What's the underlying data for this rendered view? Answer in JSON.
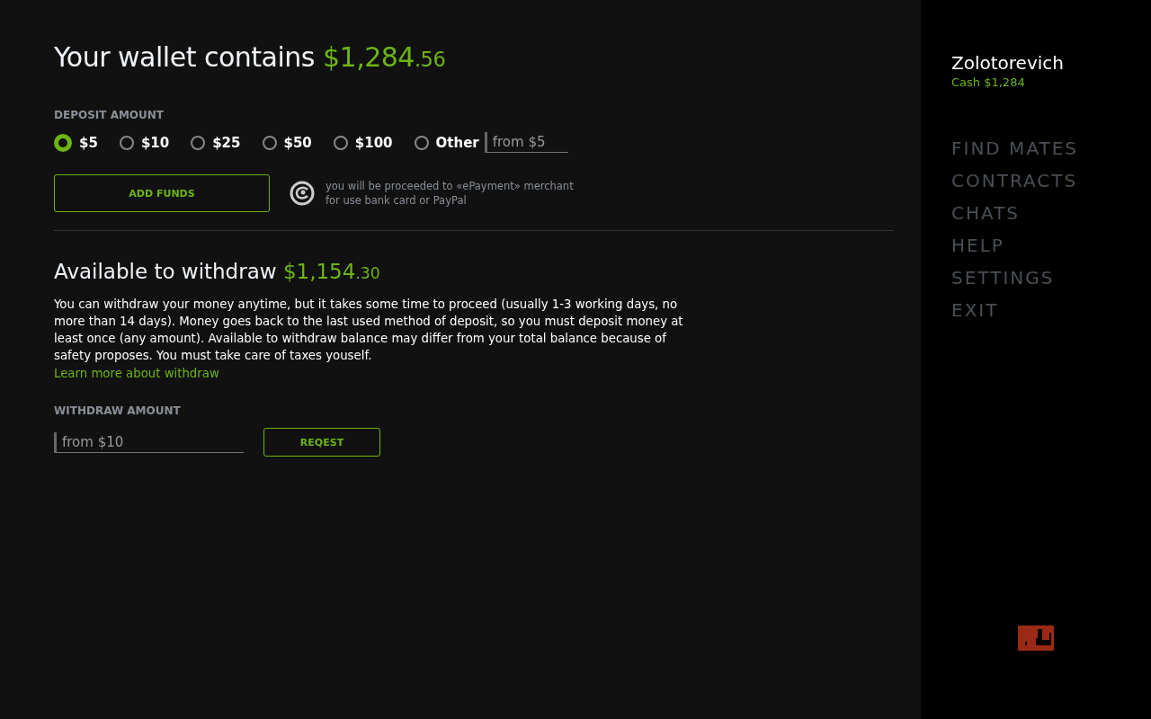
{
  "wallet": {
    "title": "Your wallet contains",
    "amount": "$1,284",
    "cents": ".56"
  },
  "deposit": {
    "label": "DEPOSIT AMOUNT",
    "options": [
      {
        "label": "$5",
        "selected": true
      },
      {
        "label": "$10",
        "selected": false
      },
      {
        "label": "$25",
        "selected": false
      },
      {
        "label": "$50",
        "selected": false
      },
      {
        "label": "$100",
        "selected": false
      },
      {
        "label": "Other",
        "selected": false
      }
    ],
    "other_placeholder": "from $5",
    "button": "ADD FUNDS",
    "note": [
      "you will be proceeded to «ePayment» merchant",
      "for use bank card or PayPal"
    ]
  },
  "withdraw": {
    "title": "Available to withdraw",
    "amount": "$1,154",
    "cents": ".30",
    "description": "You can withdraw your money anytime, but it takes some time to proceed (usually 1-3 working days, no more than 14 days). Money goes back to the last used method of deposit, so you must deposit money at least once (any amount). Available to withdraw balance may differ from your total balance because of safety proposes. You must take care of taxes youself.",
    "link": "Learn more about withdraw",
    "label": "WITHDRAW AMOUNT",
    "placeholder": "from $10",
    "button": "REQEST"
  },
  "sidebar": {
    "user": "Zolotorevich",
    "cash": "Cash $1,284",
    "menu": [
      "FIND MATES",
      "CONTRACTS",
      "CHATS",
      "HELP",
      "SETTINGS",
      "EXIT"
    ]
  }
}
